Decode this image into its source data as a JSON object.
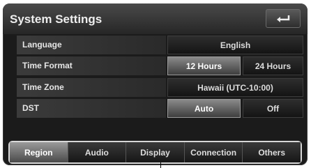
{
  "header": {
    "title": "System Settings",
    "back_icon": "back-arrow-icon"
  },
  "settings": {
    "language": {
      "label": "Language",
      "value": "English"
    },
    "time_format": {
      "label": "Time Format",
      "options": [
        "12 Hours",
        "24 Hours"
      ],
      "selected": "12 Hours"
    },
    "time_zone": {
      "label": "Time Zone",
      "value": "Hawaii (UTC-10:00)"
    },
    "dst": {
      "label": "DST",
      "options": [
        "Auto",
        "Off"
      ],
      "selected": "Auto"
    }
  },
  "tabs": [
    {
      "label": "Region",
      "active": true
    },
    {
      "label": "Audio",
      "active": false
    },
    {
      "label": "Display",
      "active": false
    },
    {
      "label": "Connection",
      "active": false
    },
    {
      "label": "Others",
      "active": false
    }
  ]
}
